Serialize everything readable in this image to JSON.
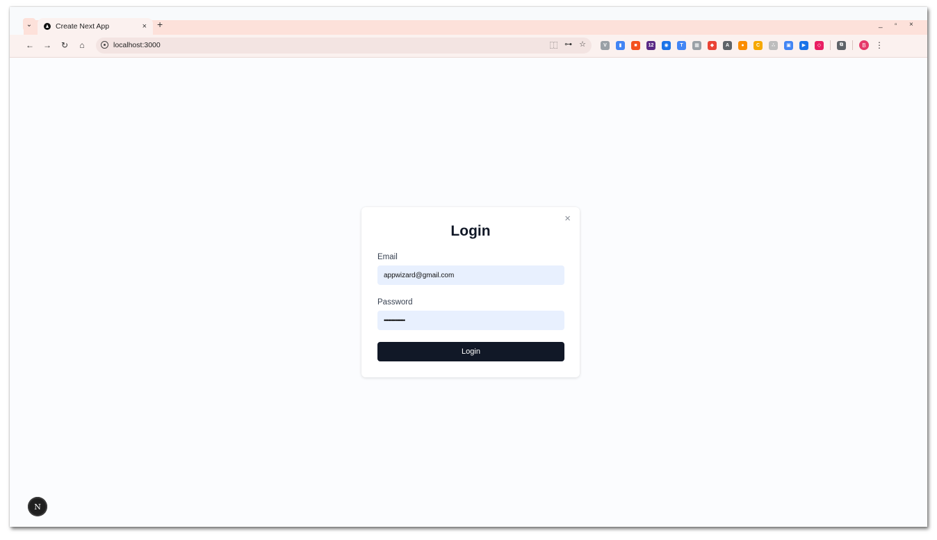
{
  "browser": {
    "tab": {
      "title": "Create Next App",
      "close_glyph": "×"
    },
    "new_tab_glyph": "+",
    "tab_menu_glyph": "⌄",
    "window_controls": {
      "minimize": "_",
      "restore": "▫",
      "close": "×"
    },
    "nav": {
      "back": "←",
      "forward": "→",
      "reload": "↻",
      "home": "⌂"
    },
    "address": {
      "url": "localhost:3000"
    },
    "omnibox_icons": {
      "translate": "⿰",
      "key": "⊶",
      "star": "☆"
    },
    "extensions": [
      {
        "name": "v-extension-icon",
        "color": "#9aa0a6",
        "glyph": "V"
      },
      {
        "name": "doc-extension-icon",
        "color": "#4285f4",
        "glyph": "▮"
      },
      {
        "name": "orange-extension-icon",
        "color": "#f4511e",
        "glyph": "■"
      },
      {
        "name": "badge-extension-icon",
        "color": "#5b2a86",
        "glyph": "12"
      },
      {
        "name": "blue-extension-icon",
        "color": "#1a73e8",
        "glyph": "◉"
      },
      {
        "name": "translate-extension-icon",
        "color": "#4285f4",
        "glyph": "T"
      },
      {
        "name": "grid-extension-icon",
        "color": "#9aa0a6",
        "glyph": "▦"
      },
      {
        "name": "red-extension-icon",
        "color": "#ea4335",
        "glyph": "◆"
      },
      {
        "name": "a-extension-icon",
        "color": "#5f6368",
        "glyph": "A"
      },
      {
        "name": "honey-extension-icon",
        "color": "#fb8c00",
        "glyph": "●"
      },
      {
        "name": "c-extension-icon",
        "color": "#f6a800",
        "glyph": "C"
      },
      {
        "name": "dots-extension-icon",
        "color": "#bdbdbd",
        "glyph": "∴"
      },
      {
        "name": "blue-square-extension-icon",
        "color": "#4285f4",
        "glyph": "▣"
      },
      {
        "name": "play-extension-icon",
        "color": "#1a73e8",
        "glyph": "▶"
      },
      {
        "name": "pink-extension-icon",
        "color": "#e91e63",
        "glyph": "◇"
      },
      {
        "name": "puzzle-extension-icon",
        "color": "#5f6368",
        "glyph": "⧉"
      }
    ],
    "profile_initial": "B",
    "menu_glyph": "⋮"
  },
  "login": {
    "title": "Login",
    "close_glyph": "×",
    "email_label": "Email",
    "email_value": "appwizard@gmail.com",
    "password_label": "Password",
    "password_value": "••••••••••••••",
    "button_label": "Login"
  },
  "next_badge": "N",
  "colors": {
    "tab_strip": "#fde1da",
    "button": "#111827",
    "input_bg": "#e8f0fe",
    "page_bg": "#fbfcfe"
  }
}
